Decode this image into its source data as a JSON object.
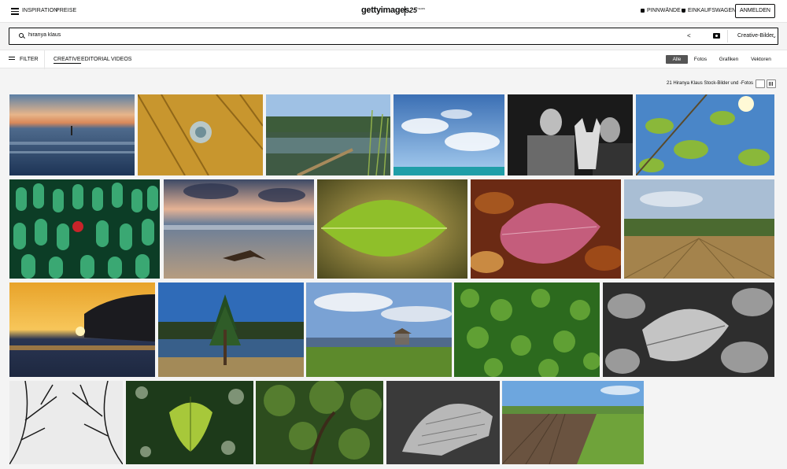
{
  "header": {
    "menu_icon": "hamburger-icon",
    "inspiration": "INSPIRATION",
    "pricing": "PREISE",
    "logo_text": "gettyimages",
    "logo_anniv": "25",
    "logo_anniv_suffix": "YEARS",
    "boards": "PINNWÄNDE",
    "cart": "EINKAUFSWAGEN",
    "signin": "ANMELDEN"
  },
  "search": {
    "value": "hiranya klaus",
    "share_glyph": "<",
    "scope": "Creative-Bilder",
    "scope_chevron": "⌄"
  },
  "filters": {
    "filter_label": "FILTER",
    "tabs": [
      "CREATIVE",
      "EDITORIAL",
      "VIDEOS"
    ],
    "active_tab": "CREATIVE",
    "media": [
      "Alle",
      "Fotos",
      "Grafiken",
      "Vektoren"
    ],
    "active_media": "Alle"
  },
  "results": {
    "count_text": "21 Hiranya Klaus Stock-Bilder und -Fotos"
  },
  "colors": {
    "accent": "#0c0d0d",
    "background": "#f4f4f4",
    "active_pill": "#555555"
  }
}
